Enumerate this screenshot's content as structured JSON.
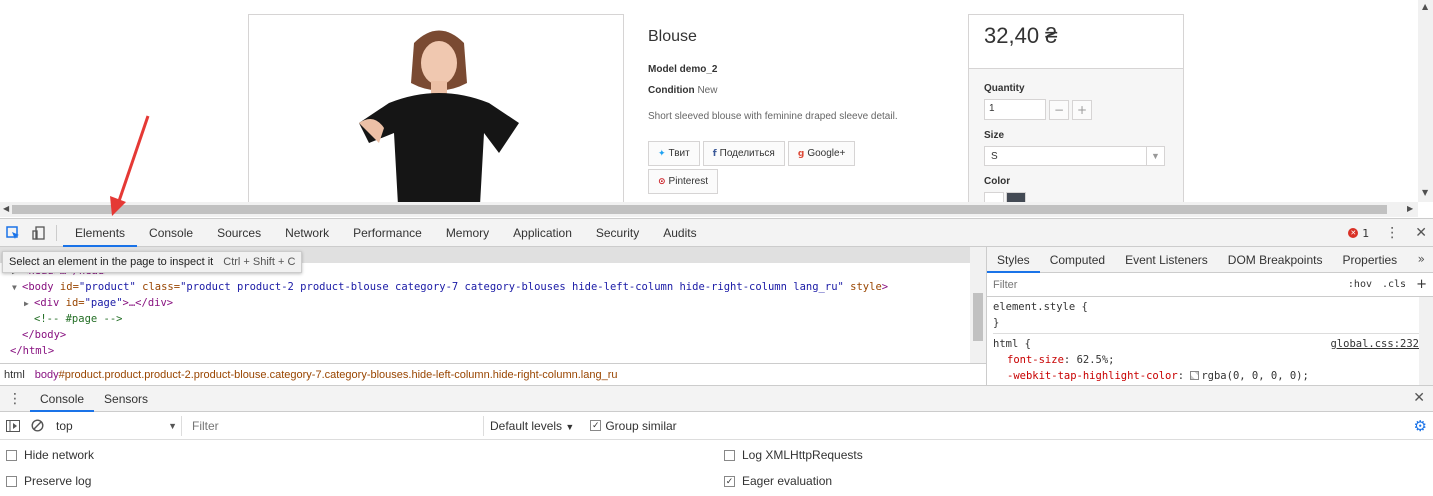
{
  "product": {
    "title": "Blouse",
    "model_label": "Model",
    "model_value": "demo_2",
    "condition_label": "Condition",
    "condition_value": "New",
    "description": "Short sleeved blouse with feminine draped sleeve detail.",
    "share_buttons": [
      "Твит",
      "Поделиться",
      "Google+",
      "Pinterest"
    ],
    "price": "32,40 ₴",
    "quantity_label": "Quantity",
    "quantity_value": "1",
    "size_label": "Size",
    "size_value": "S",
    "color_label": "Color",
    "swatch_colors": [
      "#ffffff",
      "#434a54"
    ]
  },
  "devtools": {
    "tabs": [
      "Elements",
      "Console",
      "Sources",
      "Network",
      "Performance",
      "Memory",
      "Application",
      "Security",
      "Audits"
    ],
    "active_tab": "Elements",
    "error_count": "1",
    "tooltip": {
      "text": "Select an element in the page to inspect it",
      "shortcut": "Ctrl + Shift + C"
    },
    "dom": {
      "head": "<head>…</head>",
      "body_open_tag": "<body",
      "body_attr1": " id=",
      "body_val1": "\"product\"",
      "body_attr2": " class=",
      "body_val2": "\"product product-2 product-blouse category-7 category-blouses hide-left-column hide-right-column lang_ru\"",
      "body_attr3": " style",
      "body_close": ">",
      "div_open": "<div",
      "div_attr": " id=",
      "div_val": "\"page\"",
      "div_rest": ">…</div>",
      "comment": "<!-- #page -->",
      "body_end": "</body>",
      "html_end": "</html>"
    },
    "breadcrumb": {
      "first": "html",
      "second_tag": "body",
      "second_rest": "#product.product.product-2.product-blouse.category-7.category-blouses.hide-left-column.hide-right-column.lang_ru"
    },
    "styles": {
      "tabs": [
        "Styles",
        "Computed",
        "Event Listeners",
        "DOM Breakpoints",
        "Properties"
      ],
      "filter_placeholder": "Filter",
      "hov": ":hov",
      "cls": ".cls",
      "element_style": "element.style {",
      "close_brace": "}",
      "html_selector": "html {",
      "source": "global.css:232",
      "prop1_name": "font-size",
      "prop1_value": "62.5%;",
      "prop2_name": "-webkit-tap-highlight-color",
      "prop2_value": "rgba(0, 0, 0, 0);"
    },
    "drawer": {
      "tabs": [
        "Console",
        "Sensors"
      ],
      "context": "top",
      "filter_placeholder": "Filter",
      "levels": "Default levels",
      "group_similar": "Group similar",
      "options": {
        "hide_network": "Hide network",
        "preserve_log": "Preserve log",
        "log_xhr": "Log XMLHttpRequests",
        "eager_eval": "Eager evaluation"
      }
    }
  }
}
